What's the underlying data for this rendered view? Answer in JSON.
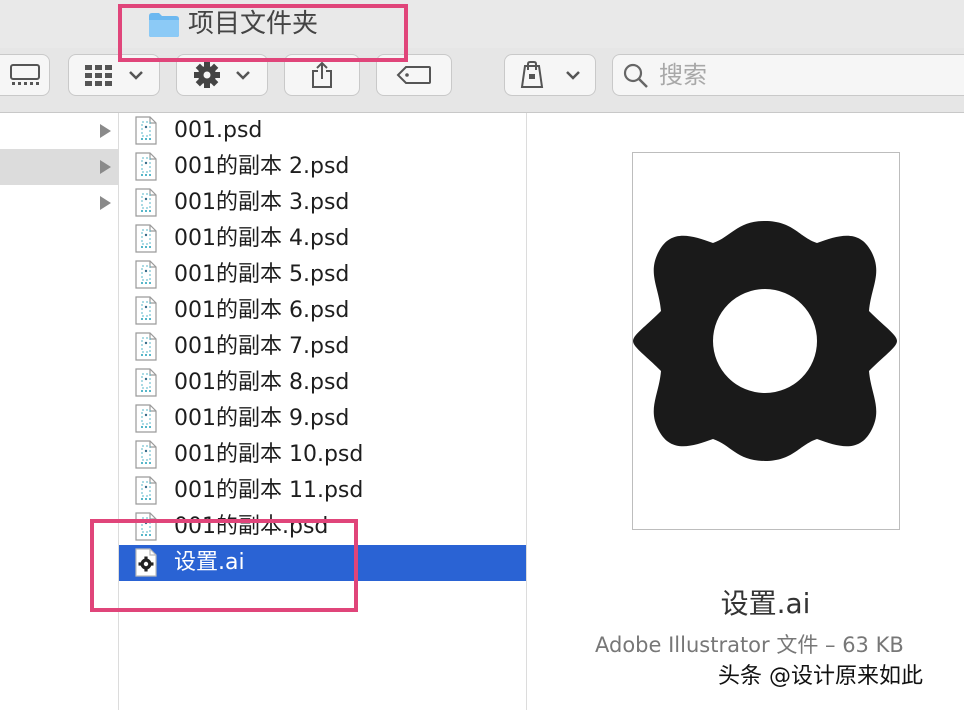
{
  "window": {
    "title": "项目文件夹"
  },
  "toolbar": {
    "buttons": [
      {
        "icon": "column-view-icon"
      },
      {
        "icon": "gallery-view-icon"
      },
      {
        "icon": "gear-icon"
      },
      {
        "icon": "share-icon"
      },
      {
        "icon": "tag-icon"
      },
      {
        "icon": "bag-icon"
      }
    ],
    "search_placeholder": "搜索"
  },
  "files": [
    {
      "name": "001.psd",
      "type": "psd"
    },
    {
      "name": "001的副本 2.psd",
      "type": "psd"
    },
    {
      "name": "001的副本 3.psd",
      "type": "psd"
    },
    {
      "name": "001的副本 4.psd",
      "type": "psd"
    },
    {
      "name": "001的副本 5.psd",
      "type": "psd"
    },
    {
      "name": "001的副本 6.psd",
      "type": "psd"
    },
    {
      "name": "001的副本 7.psd",
      "type": "psd"
    },
    {
      "name": "001的副本 8.psd",
      "type": "psd"
    },
    {
      "name": "001的副本 9.psd",
      "type": "psd"
    },
    {
      "name": "001的副本 10.psd",
      "type": "psd"
    },
    {
      "name": "001的副本 11.psd",
      "type": "psd"
    },
    {
      "name": "001的副本.psd",
      "type": "psd"
    },
    {
      "name": "设置.ai",
      "type": "ai",
      "selected": true
    }
  ],
  "preview": {
    "name": "设置.ai",
    "meta": "Adobe Illustrator 文件 – 63 KB"
  },
  "watermark": "头条 @设计原来如此",
  "colors": {
    "selection": "#2a63d4",
    "highlight": "#e0457a",
    "folder": "#6cb8f0"
  }
}
